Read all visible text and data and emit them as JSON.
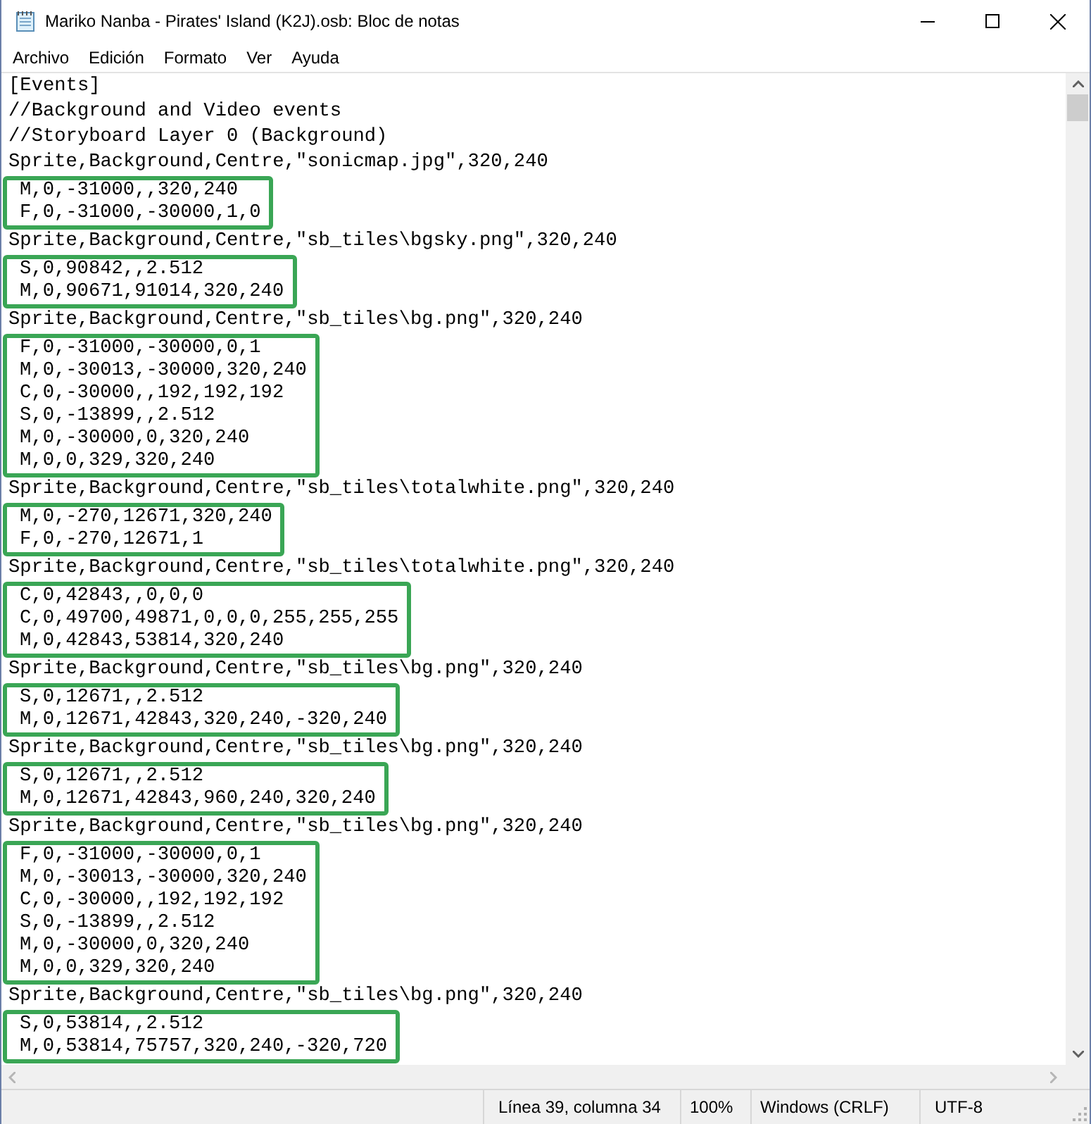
{
  "window": {
    "title": "Mariko Nanba - Pirates' Island (K2J).osb: Bloc de notas"
  },
  "menu": [
    "Archivo",
    "Edición",
    "Formato",
    "Ver",
    "Ayuda"
  ],
  "document": {
    "blocks": [
      {
        "kind": "plain",
        "lines": [
          "[Events]",
          "//Background and Video events",
          "//Storyboard Layer 0 (Background)",
          "Sprite,Background,Centre,\"sonicmap.jpg\",320,240"
        ]
      },
      {
        "kind": "boxed",
        "lines": [
          "M,0,-31000,,320,240",
          "F,0,-31000,-30000,1,0"
        ]
      },
      {
        "kind": "plain",
        "lines": [
          "Sprite,Background,Centre,\"sb_tiles\\bgsky.png\",320,240"
        ]
      },
      {
        "kind": "boxed",
        "lines": [
          "S,0,90842,,2.512",
          "M,0,90671,91014,320,240"
        ]
      },
      {
        "kind": "plain",
        "lines": [
          "Sprite,Background,Centre,\"sb_tiles\\bg.png\",320,240"
        ]
      },
      {
        "kind": "boxed",
        "lines": [
          "F,0,-31000,-30000,0,1",
          "M,0,-30013,-30000,320,240",
          "C,0,-30000,,192,192,192",
          "S,0,-13899,,2.512",
          "M,0,-30000,0,320,240",
          "M,0,0,329,320,240"
        ]
      },
      {
        "kind": "plain",
        "lines": [
          "Sprite,Background,Centre,\"sb_tiles\\totalwhite.png\",320,240"
        ]
      },
      {
        "kind": "boxed",
        "lines": [
          "M,0,-270,12671,320,240",
          "F,0,-270,12671,1"
        ]
      },
      {
        "kind": "plain",
        "lines": [
          "Sprite,Background,Centre,\"sb_tiles\\totalwhite.png\",320,240"
        ]
      },
      {
        "kind": "boxed",
        "lines": [
          "C,0,42843,,0,0,0",
          "C,0,49700,49871,0,0,0,255,255,255",
          "M,0,42843,53814,320,240"
        ]
      },
      {
        "kind": "plain",
        "lines": [
          "Sprite,Background,Centre,\"sb_tiles\\bg.png\",320,240"
        ]
      },
      {
        "kind": "boxed",
        "lines": [
          "S,0,12671,,2.512",
          "M,0,12671,42843,320,240,-320,240"
        ]
      },
      {
        "kind": "plain",
        "lines": [
          "Sprite,Background,Centre,\"sb_tiles\\bg.png\",320,240"
        ]
      },
      {
        "kind": "boxed",
        "lines": [
          "S,0,12671,,2.512",
          "M,0,12671,42843,960,240,320,240"
        ]
      },
      {
        "kind": "plain",
        "lines": [
          "Sprite,Background,Centre,\"sb_tiles\\bg.png\",320,240"
        ]
      },
      {
        "kind": "boxed",
        "lines": [
          "F,0,-31000,-30000,0,1",
          "M,0,-30013,-30000,320,240",
          "C,0,-30000,,192,192,192",
          "S,0,-13899,,2.512",
          "M,0,-30000,0,320,240",
          "M,0,0,329,320,240"
        ]
      },
      {
        "kind": "plain",
        "lines": [
          "Sprite,Background,Centre,\"sb_tiles\\bg.png\",320,240"
        ]
      },
      {
        "kind": "boxed",
        "lines": [
          "S,0,53814,,2.512",
          "M,0,53814,75757,320,240,-320,720"
        ]
      }
    ]
  },
  "status_bar": {
    "position": "Línea 39, columna 34",
    "zoom": "100%",
    "line_endings": "Windows (CRLF)",
    "encoding": "UTF-8"
  }
}
